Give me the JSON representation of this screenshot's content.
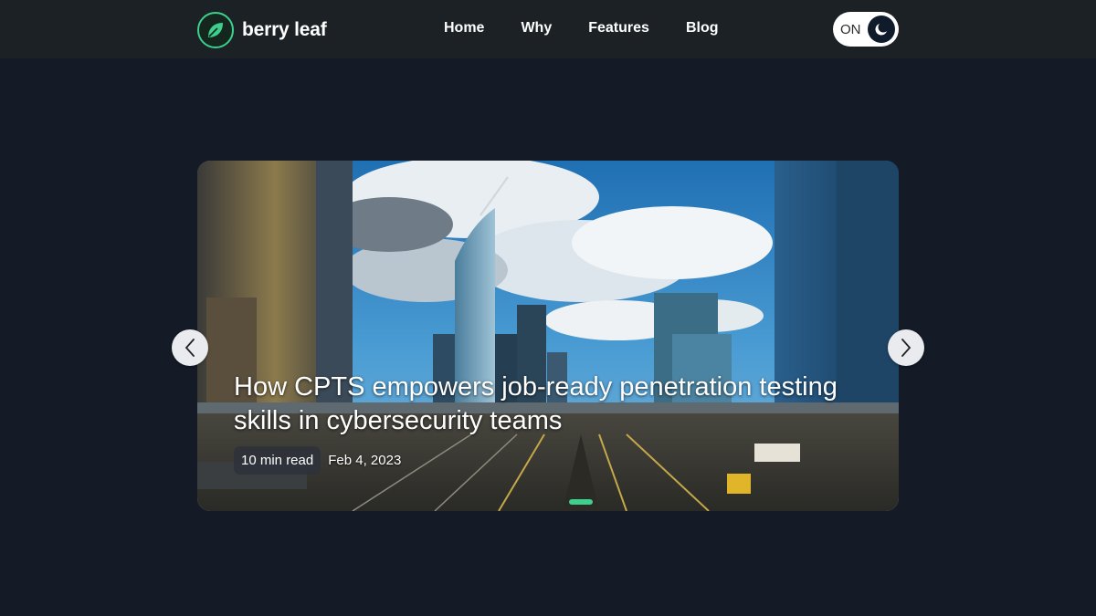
{
  "brand": {
    "name": "berry leaf",
    "accent": "#3ccf8e",
    "icon": "leaf-icon"
  },
  "nav": {
    "items": [
      {
        "label": "Home"
      },
      {
        "label": "Why"
      },
      {
        "label": "Features"
      },
      {
        "label": "Blog"
      }
    ]
  },
  "theme_toggle": {
    "label": "ON",
    "icon": "moon-icon"
  },
  "carousel": {
    "slides": [
      {
        "title": "How CPTS empowers job-ready penetration testing skills in cybersecurity teams",
        "read_time": "10 min read",
        "date": "Feb 4, 2023",
        "image": "city skyline with railway yard"
      }
    ],
    "active_index": 0,
    "prev_icon": "chevron-left-icon",
    "next_icon": "chevron-right-icon"
  },
  "colors": {
    "page_bg": "#141a26",
    "nav_bg": "#1b2124",
    "dot_active": "#3ccf8e"
  }
}
